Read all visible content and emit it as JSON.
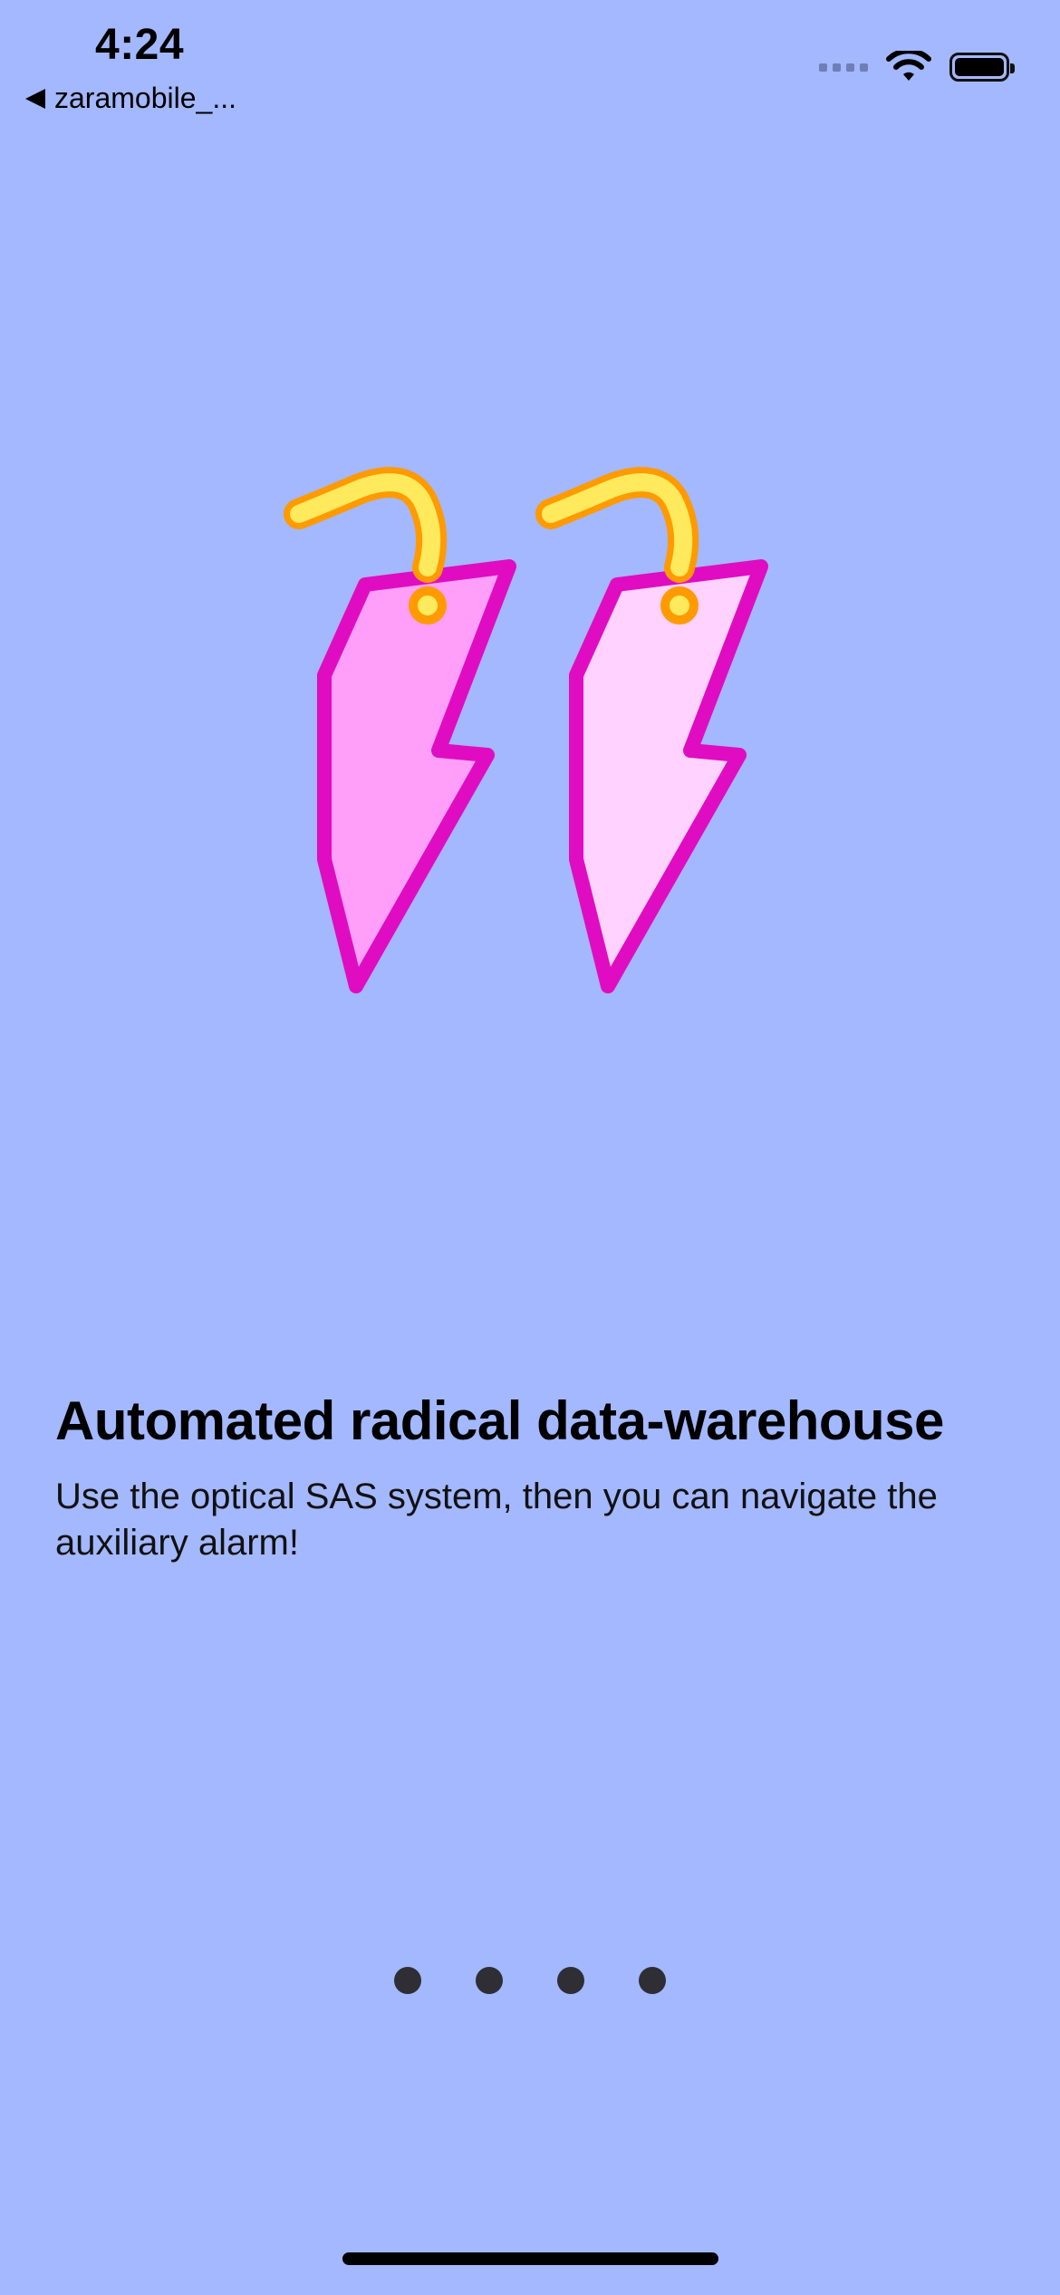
{
  "status_bar": {
    "time": "4:24",
    "back_label": "zaramobile_...",
    "icons": [
      "signal-icon",
      "wifi-icon",
      "battery-icon"
    ]
  },
  "hero": {
    "icon": "lightning-earrings-icon",
    "colors": {
      "hook_outline": "#ff9a00",
      "hook_fill": "#ffe95c",
      "bolt_outline": "#e00cc2",
      "bolt_fill_left": "#ff9ff9",
      "bolt_fill_right": "#ffd2ff"
    }
  },
  "onboarding": {
    "title": "Automated radical data-warehouse",
    "description": "Use the optical SAS system, then you can navigate the auxiliary alarm!"
  },
  "pagination": {
    "total_pages": 4
  },
  "colors": {
    "background": "#a3b8fe",
    "dot": "#2e2e34",
    "text": "#000000"
  }
}
